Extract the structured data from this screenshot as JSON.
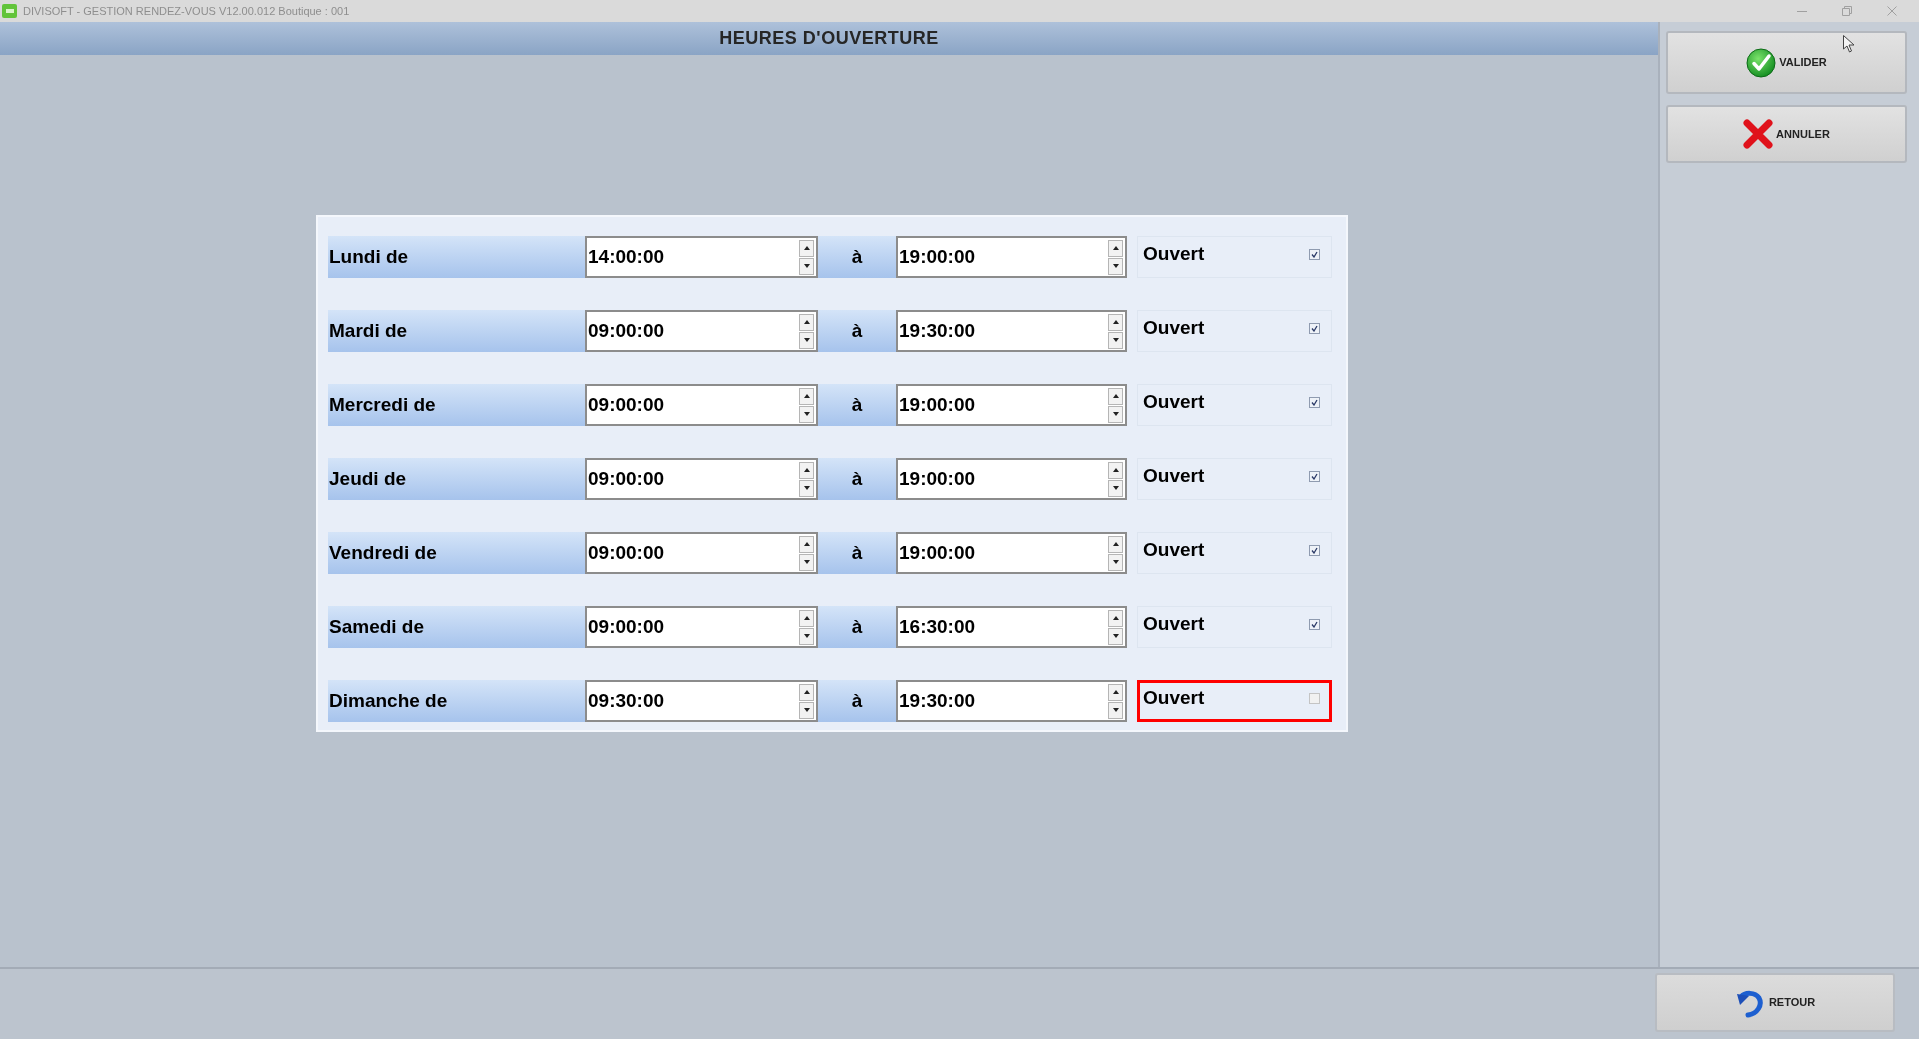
{
  "window": {
    "title": "DIVISOFT - GESTION RENDEZ-VOUS V12.00.012 Boutique : 001"
  },
  "header": {
    "title": "HEURES D'OUVERTURE"
  },
  "schedule": [
    {
      "day_label": "Lundi de",
      "from": "14:00:00",
      "separator": "à",
      "to": "19:00:00",
      "status_label": "Ouvert",
      "checked": true,
      "highlighted": false
    },
    {
      "day_label": "Mardi de",
      "from": "09:00:00",
      "separator": "à",
      "to": "19:30:00",
      "status_label": "Ouvert",
      "checked": true,
      "highlighted": false
    },
    {
      "day_label": "Mercredi de",
      "from": "09:00:00",
      "separator": "à",
      "to": "19:00:00",
      "status_label": "Ouvert",
      "checked": true,
      "highlighted": false
    },
    {
      "day_label": "Jeudi de",
      "from": "09:00:00",
      "separator": "à",
      "to": "19:00:00",
      "status_label": "Ouvert",
      "checked": true,
      "highlighted": false
    },
    {
      "day_label": "Vendredi de",
      "from": "09:00:00",
      "separator": "à",
      "to": "19:00:00",
      "status_label": "Ouvert",
      "checked": true,
      "highlighted": false
    },
    {
      "day_label": "Samedi de",
      "from": "09:00:00",
      "separator": "à",
      "to": "16:30:00",
      "status_label": "Ouvert",
      "checked": true,
      "highlighted": false
    },
    {
      "day_label": "Dimanche de",
      "from": "09:30:00",
      "separator": "à",
      "to": "19:30:00",
      "status_label": "Ouvert",
      "checked": false,
      "highlighted": true
    }
  ],
  "actions": [
    {
      "label": "VALIDER",
      "kind": "confirm"
    },
    {
      "label": "ANNULER",
      "kind": "cancel"
    }
  ],
  "footer": {
    "back_button": "RETOUR"
  }
}
